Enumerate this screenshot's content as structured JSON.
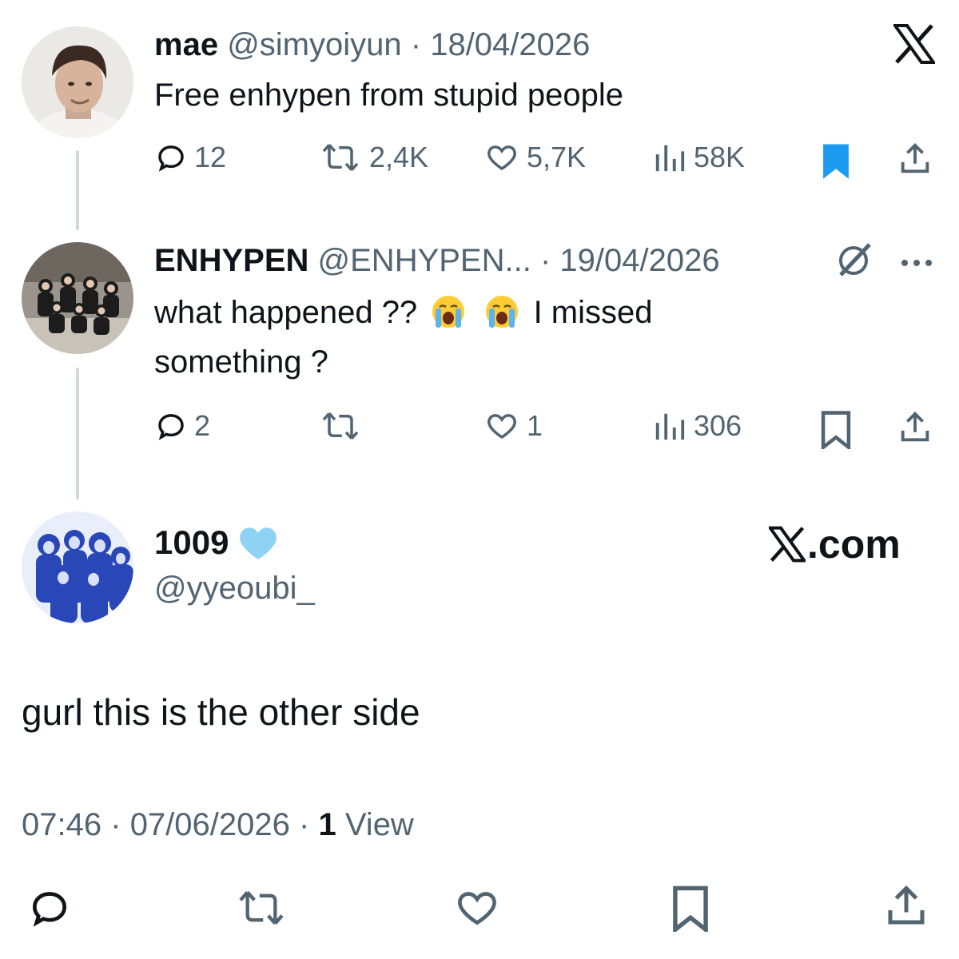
{
  "tweets": [
    {
      "display_name": "mae",
      "handle": "@simyoiyun",
      "separator": "·",
      "date": "18/04/2026",
      "text": "Free enhypen from stupid people",
      "actions": {
        "replies": "12",
        "reposts": "2,4K",
        "likes": "5,7K",
        "views": "58K",
        "bookmarked": true
      }
    },
    {
      "display_name": "ENHYPEN",
      "handle": "@ENHYPEN...",
      "separator": "·",
      "date": "19/04/2026",
      "text_part1": "what happened ??",
      "text_part2": "I missed",
      "text_part3": "something ?",
      "emoji": "loudly-crying-face",
      "actions": {
        "replies": "2",
        "reposts": "",
        "likes": "1",
        "views": "306",
        "bookmarked": false
      }
    }
  ],
  "main_tweet": {
    "display_name": "1009",
    "badge_icon": "light-blue-heart",
    "handle": "@yyeoubi_",
    "text": "gurl this is the other side",
    "time": "07:46",
    "separator": "·",
    "date": "07/06/2026",
    "views_count": "1",
    "views_label": "View"
  },
  "watermark": {
    "x_logo": "X",
    "site": "X.com"
  },
  "colors": {
    "accent": "#1d9bf0",
    "muted": "#536471",
    "text": "#0f1419",
    "heart_blue": "#8fd3f4"
  }
}
